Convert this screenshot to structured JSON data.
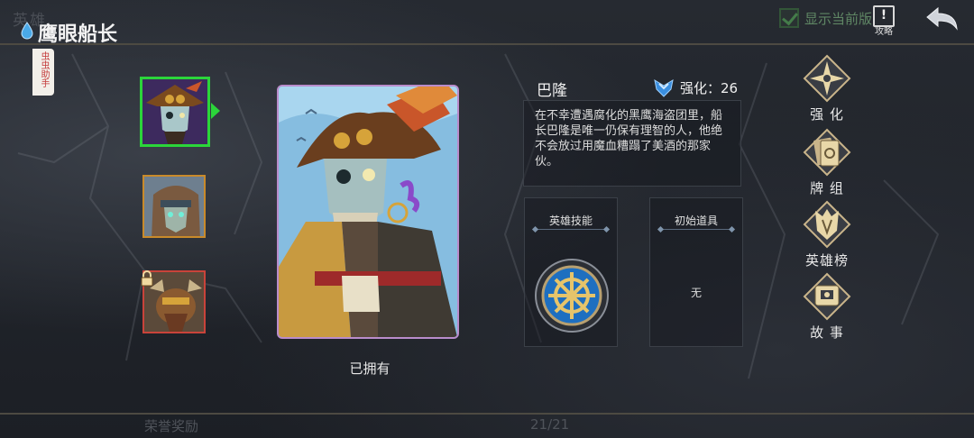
{
  "header": {
    "ghost_title": "英雄",
    "title": "鹰眼船长",
    "show_current_label": "显示当前版",
    "show_current_checked": true,
    "guide_label": "攻略",
    "back_icon": "back-arrow-icon"
  },
  "side_tab": {
    "label": "虫虫助手"
  },
  "hero_list": [
    {
      "name": "eyepatch-captain",
      "selected": true,
      "frame_color": "#2bd53a"
    },
    {
      "name": "hooded-wanderer",
      "selected": false,
      "frame_color": "#c98a2a"
    },
    {
      "name": "horned-beast",
      "selected": false,
      "locked": true,
      "frame_color": "#c9433a"
    }
  ],
  "card": {
    "status": "已拥有",
    "frame_color": "#b98ccb"
  },
  "info": {
    "name": "巴隆",
    "enhance_label": "强化：",
    "enhance_value": "26",
    "description": "在不幸遭遇腐化的黑鹰海盗团里，船长巴隆是唯一仍保有理智的人，他绝不会放过用魔血糟蹋了美酒的那家伙。",
    "skill_title": "英雄技能",
    "skill_icon": "ship-wheel-icon",
    "item_title": "初始道具",
    "item_value": "无"
  },
  "menu": [
    {
      "label": "强 化",
      "icon": "compass-star-icon"
    },
    {
      "label": "牌 组",
      "icon": "card-deck-icon"
    },
    {
      "label": "英雄榜",
      "icon": "banner-crest-icon"
    },
    {
      "label": "故 事",
      "icon": "storybook-icon"
    }
  ],
  "bottom": {
    "reward_label": "荣誉奖励",
    "page": "21/21"
  }
}
